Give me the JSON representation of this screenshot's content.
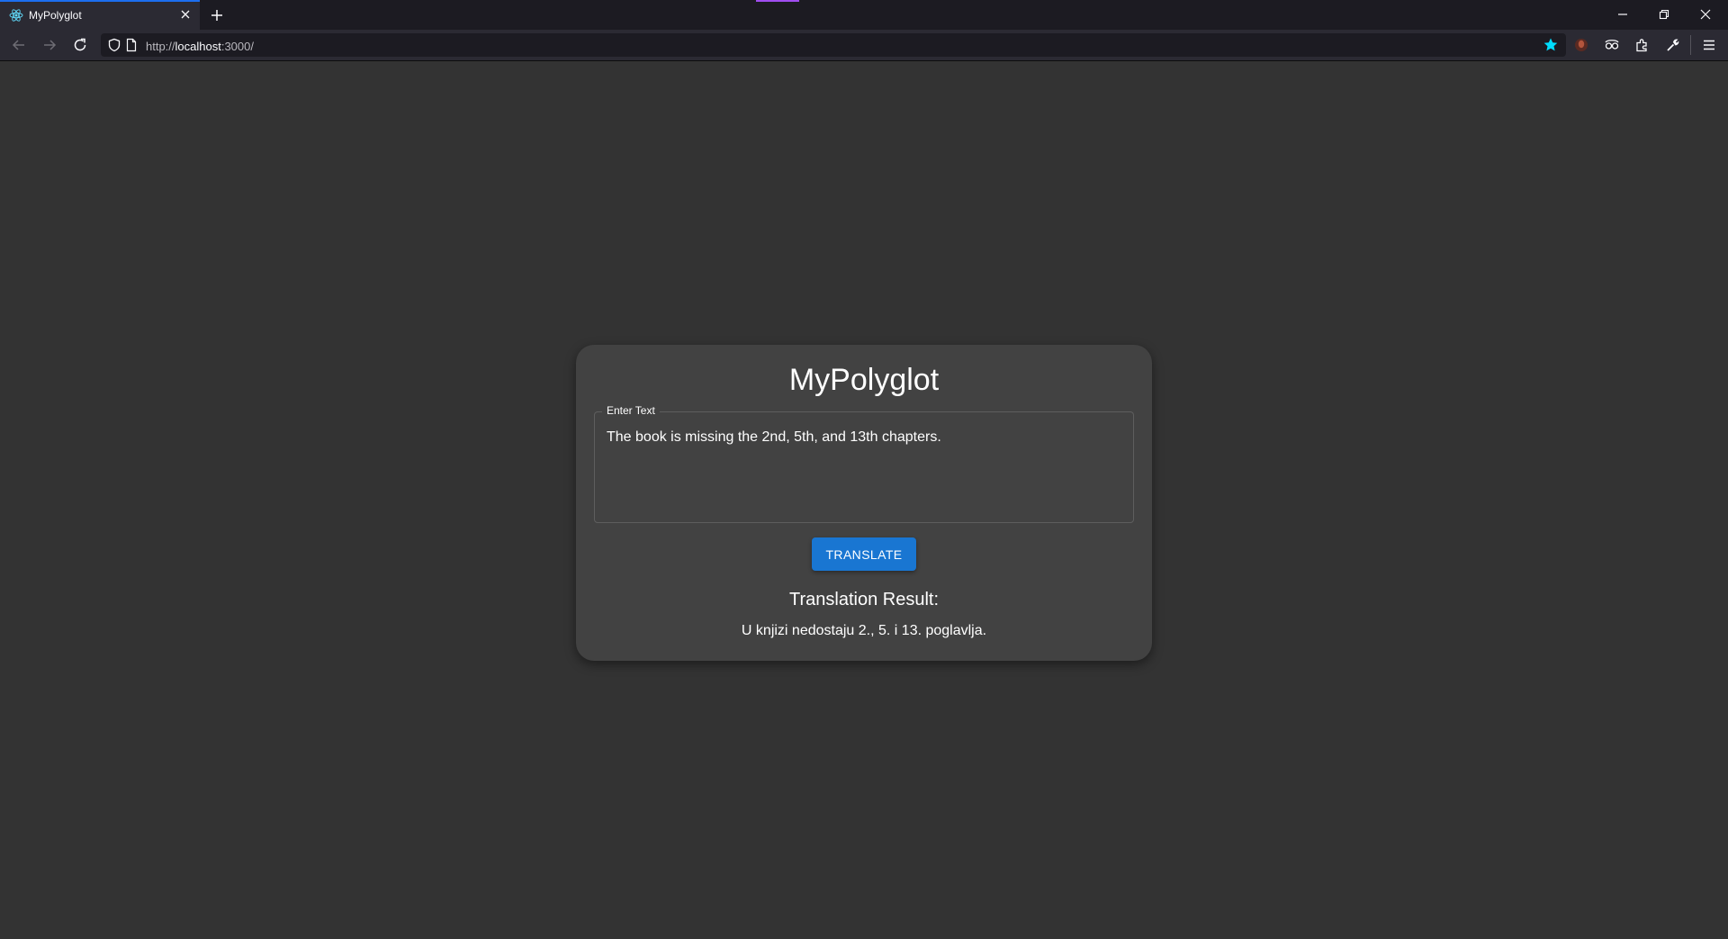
{
  "browser": {
    "tab": {
      "title": "MyPolyglot"
    },
    "url": {
      "base": "http://",
      "host": "localhost",
      "rest": ":3000/"
    },
    "icons": [
      "react-favicon-icon",
      "close-icon",
      "plus-icon",
      "minimize-icon",
      "restore-icon",
      "window-close-icon",
      "back-arrow-icon",
      "forward-arrow-icon",
      "reload-icon",
      "shield-icon",
      "page-icon",
      "bookmark-star-icon",
      "extension-avatar-icon",
      "extension-glasses-icon",
      "puzzle-icon",
      "wrench-icon",
      "menu-icon"
    ],
    "colors": {
      "tabbar": "#1c1b22",
      "toolbar": "#2b2a33",
      "accent": "#1c6ff0",
      "star": "#00ddff"
    }
  },
  "app": {
    "title": "MyPolyglot",
    "input": {
      "label": "Enter Text",
      "value": "The book is missing the 2nd, 5th, and 13th chapters."
    },
    "translate_label": "TRANSLATE",
    "result": {
      "heading": "Translation Result:",
      "text": "U knjizi nedostaju 2., 5. i 13. poglavlja."
    },
    "colors": {
      "background": "#333333",
      "card": "#424242",
      "button": "#1976d2"
    }
  }
}
